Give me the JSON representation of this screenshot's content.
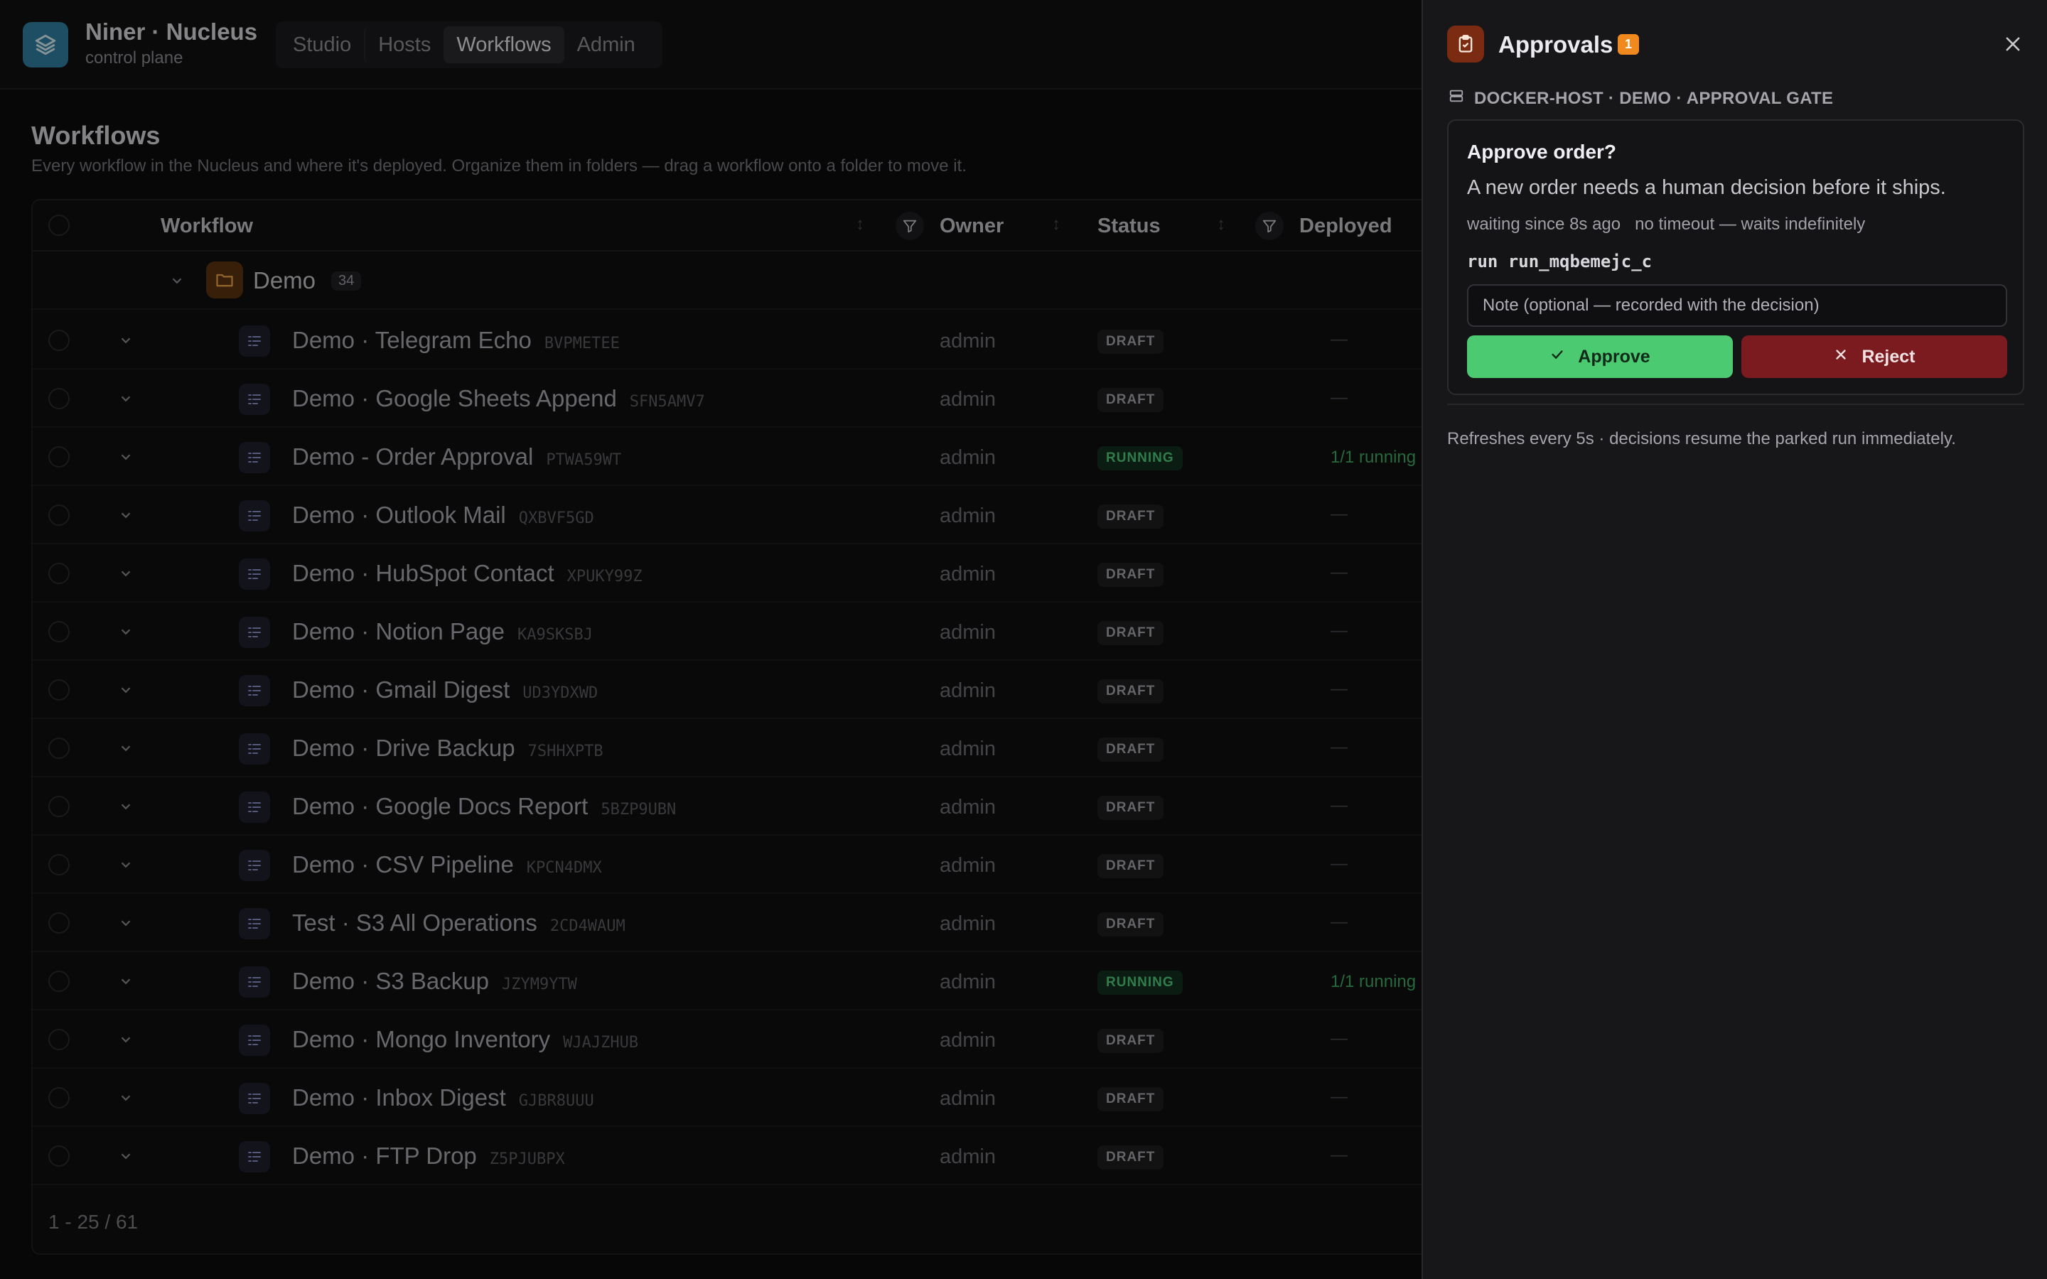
{
  "brand": {
    "name": "Niner · Nucleus",
    "subtitle": "control plane"
  },
  "nav": {
    "tabs": [
      "Studio",
      "Hosts",
      "Workflows",
      "Admin"
    ],
    "active": "Workflows"
  },
  "page": {
    "title": "Workflows",
    "description": "Every workflow in the Nucleus and where it's deployed. Organize them in folders — drag a workflow onto a folder to move it."
  },
  "table": {
    "columns": {
      "workflow": "Workflow",
      "owner": "Owner",
      "status": "Status",
      "deployed": "Deployed"
    },
    "folder": {
      "name": "Demo",
      "count": "34"
    },
    "rows": [
      {
        "name": "Demo · Telegram Echo",
        "code": "BVPMETEE",
        "owner": "admin",
        "status": "DRAFT",
        "deployed": "—"
      },
      {
        "name": "Demo · Google Sheets Append",
        "code": "SFN5AMV7",
        "owner": "admin",
        "status": "DRAFT",
        "deployed": "—"
      },
      {
        "name": "Demo - Order Approval",
        "code": "PTWA59WT",
        "owner": "admin",
        "status": "RUNNING",
        "deployed": "1/1 running"
      },
      {
        "name": "Demo · Outlook Mail",
        "code": "QXBVF5GD",
        "owner": "admin",
        "status": "DRAFT",
        "deployed": "—"
      },
      {
        "name": "Demo · HubSpot Contact",
        "code": "XPUKY99Z",
        "owner": "admin",
        "status": "DRAFT",
        "deployed": "—"
      },
      {
        "name": "Demo · Notion Page",
        "code": "KA9SKSBJ",
        "owner": "admin",
        "status": "DRAFT",
        "deployed": "—"
      },
      {
        "name": "Demo · Gmail Digest",
        "code": "UD3YDXWD",
        "owner": "admin",
        "status": "DRAFT",
        "deployed": "—"
      },
      {
        "name": "Demo · Drive Backup",
        "code": "7SHHXPTB",
        "owner": "admin",
        "status": "DRAFT",
        "deployed": "—"
      },
      {
        "name": "Demo · Google Docs Report",
        "code": "5BZP9UBN",
        "owner": "admin",
        "status": "DRAFT",
        "deployed": "—"
      },
      {
        "name": "Demo · CSV Pipeline",
        "code": "KPCN4DMX",
        "owner": "admin",
        "status": "DRAFT",
        "deployed": "—"
      },
      {
        "name": "Test · S3 All Operations",
        "code": "2CD4WAUM",
        "owner": "admin",
        "status": "DRAFT",
        "deployed": "—"
      },
      {
        "name": "Demo · S3 Backup",
        "code": "JZYM9YTW",
        "owner": "admin",
        "status": "RUNNING",
        "deployed": "1/1 running"
      },
      {
        "name": "Demo · Mongo Inventory",
        "code": "WJAJZHUB",
        "owner": "admin",
        "status": "DRAFT",
        "deployed": "—"
      },
      {
        "name": "Demo · Inbox Digest",
        "code": "GJBR8UUU",
        "owner": "admin",
        "status": "DRAFT",
        "deployed": "—"
      },
      {
        "name": "Demo · FTP Drop",
        "code": "Z5PJUBPX",
        "owner": "admin",
        "status": "DRAFT",
        "deployed": "—"
      }
    ],
    "pager": "1 - 25 / 61"
  },
  "approvals": {
    "title": "Approvals",
    "count": "1",
    "host": "DOCKER-HOST · DEMO · APPROVAL GATE",
    "card": {
      "title": "Approve order?",
      "description": "A new order needs a human decision before it ships.",
      "waiting": "waiting since 8s ago",
      "timeout": "no timeout — waits indefinitely",
      "run": "run run_mqbemejc_c",
      "note_placeholder": "Note (optional — recorded with the decision)",
      "approve_label": "Approve",
      "reject_label": "Reject"
    },
    "refresh_note": "Refreshes every 5s · decisions resume the parked run immediately."
  },
  "colors": {
    "accent_green": "#4cca72",
    "reject_red": "#7b1a1f",
    "badge_orange": "#f08a1f"
  }
}
